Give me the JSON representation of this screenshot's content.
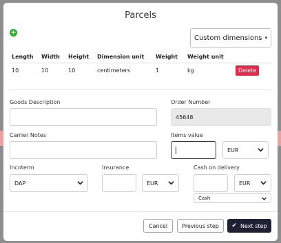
{
  "modal": {
    "title": "Parcels",
    "add_icon_glyph": "+",
    "dimensions_button": "Custom dimensions",
    "dimensions_caret": "▾"
  },
  "table": {
    "headers": [
      "Length",
      "Width",
      "Height",
      "Dimension unit",
      "Weight",
      "Weight unit"
    ],
    "rows": [
      {
        "cells": [
          "10",
          "10",
          "10",
          "centimeters",
          "1",
          "kg"
        ],
        "action": "Delete"
      }
    ]
  },
  "form": {
    "goods_description": {
      "label": "Goods Description",
      "value": ""
    },
    "order_number": {
      "label": "Order Number",
      "value": "45648"
    },
    "carrier_notes": {
      "label": "Carrier Notes",
      "value": ""
    },
    "items_value": {
      "label": "Items value",
      "value": "",
      "currency": "EUR"
    },
    "incoterm": {
      "label": "Incoterm",
      "value": "DAP"
    },
    "insurance": {
      "label": "Insurance",
      "value": "",
      "currency": "EUR"
    },
    "cash_on_delivery": {
      "label": "Cash on delivery",
      "value": "",
      "currency": "EUR",
      "method": "Cash"
    }
  },
  "footer": {
    "cancel": "Cancel",
    "previous": "Previous step",
    "next": "Next step",
    "next_icon": "✔"
  },
  "colors": {
    "primary_dark": "#1d2133",
    "danger": "#e6294b",
    "success": "#27b12a"
  }
}
